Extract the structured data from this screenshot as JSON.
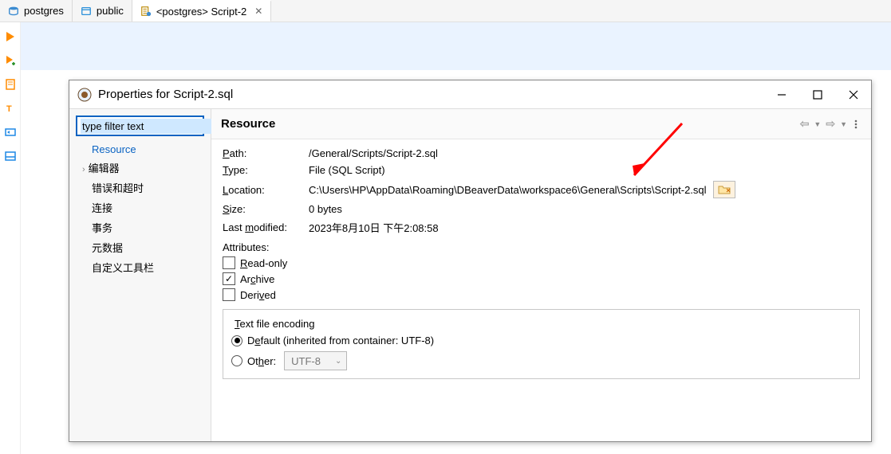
{
  "tabs": [
    {
      "label": "postgres",
      "iconColor": "#2b6cb0"
    },
    {
      "label": "public",
      "iconColor": "#2b90d9"
    },
    {
      "label": "<postgres> Script-2",
      "iconColor": "#ff9900",
      "active": true
    }
  ],
  "ribbon": [
    {
      "name": "run-icon",
      "color": "orange"
    },
    {
      "name": "run-plus-icon",
      "color": "orange"
    },
    {
      "name": "script-icon",
      "color": "orange"
    },
    {
      "name": "text-icon",
      "color": "orange"
    },
    {
      "name": "output-icon",
      "color": "blue"
    },
    {
      "name": "panel-icon",
      "color": "blue"
    }
  ],
  "dialog": {
    "title": "Properties for Script-2.sql",
    "filter_placeholder": "type filter text",
    "sidebar": [
      {
        "label": "Resource",
        "selected": true,
        "expandable": false
      },
      {
        "label": "编辑器",
        "selected": false,
        "expandable": true
      },
      {
        "label": "错误和超时",
        "selected": false,
        "expandable": false
      },
      {
        "label": "连接",
        "selected": false,
        "expandable": false
      },
      {
        "label": "事务",
        "selected": false,
        "expandable": false
      },
      {
        "label": "元数据",
        "selected": false,
        "expandable": false
      },
      {
        "label": "自定义工具栏",
        "selected": false,
        "expandable": false
      }
    ],
    "section_title": "Resource",
    "fields": {
      "path_label": "Path:",
      "path_value": "/General/Scripts/Script-2.sql",
      "type_label": "Type:",
      "type_value": "File  (SQL Script)",
      "location_label": "Location:",
      "location_value": "C:\\Users\\HP\\AppData\\Roaming\\DBeaverData\\workspace6\\General\\Scripts\\Script-2.sql",
      "size_label": "Size:",
      "size_value": "0  bytes",
      "modified_label": "Last modified:",
      "modified_value": "2023年8月10日 下午2:08:58"
    },
    "attributes": {
      "title": "Attributes:",
      "readonly_label": "Read-only",
      "readonly_checked": false,
      "archive_label": "Archive",
      "archive_checked": true,
      "derived_label": "Derived",
      "derived_checked": false
    },
    "encoding": {
      "legend": "Text file encoding",
      "default_label": "Default (inherited from container: UTF-8)",
      "default_selected": true,
      "other_label": "Other:",
      "other_selected": false,
      "other_value": "UTF-8"
    }
  }
}
